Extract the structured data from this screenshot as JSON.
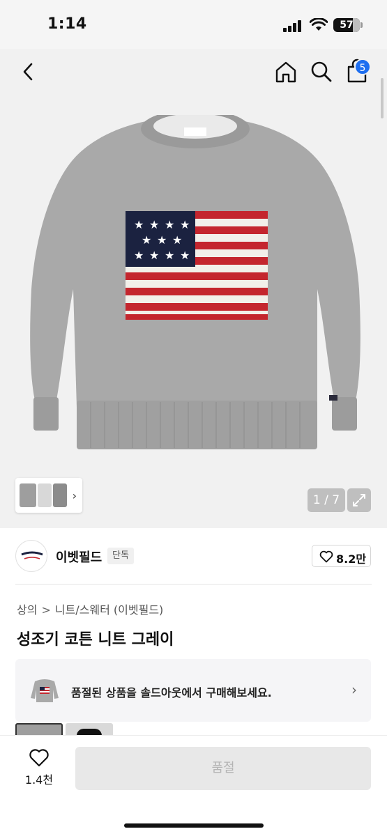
{
  "status_bar": {
    "time": "1:14",
    "battery": "57"
  },
  "nav": {
    "back_icon": "chevron-left-icon",
    "home_icon": "home-icon",
    "search_icon": "search-icon",
    "cart_icon": "shopping-bag-icon",
    "cart_count": "5"
  },
  "gallery": {
    "counter": "1 / 7",
    "expand_icon": "expand-icon",
    "thumb_chevron": "›"
  },
  "brand": {
    "name": "이벳필드",
    "tag": "단독",
    "likes": "8.2만"
  },
  "breadcrumb": {
    "level1": "상의",
    "separator": ">",
    "level2": "니트/스웨터 (이벳필드)"
  },
  "product": {
    "title": "성조기 코튼 니트 그레이"
  },
  "soldout_banner": {
    "text": "품절된 상품을 솔드아웃에서 구매해보세요.",
    "chevron": "›"
  },
  "bottom_bar": {
    "like_count": "1.4천",
    "buy_label": "품절"
  },
  "colors": {
    "accent": "#1d6ef0",
    "sweater_gray": "#a8a8a8",
    "flag_navy": "#1b2240",
    "flag_red": "#c4262e"
  }
}
